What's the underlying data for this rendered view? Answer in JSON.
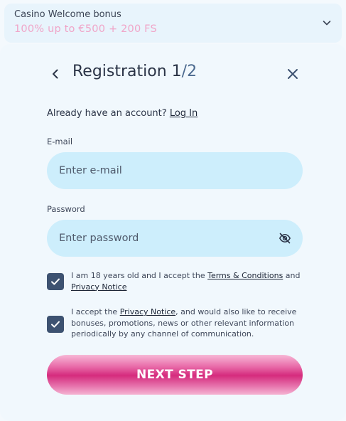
{
  "bonus": {
    "title": "Casino Welcome bonus",
    "offer": "100% up to €500 + 200 FS",
    "icon": "chevron-down-icon"
  },
  "header": {
    "title_main": "Registration 1",
    "title_sep": "/",
    "title_total": "2",
    "back_icon": "chevron-left-icon",
    "close_icon": "close-icon"
  },
  "account": {
    "prompt": "Already have an account?",
    "login_label": "Log In"
  },
  "form": {
    "email_label": "E-mail",
    "email_placeholder": "Enter e-mail",
    "email_value": "",
    "password_label": "Password",
    "password_placeholder": "Enter password",
    "password_value": "",
    "password_icon": "eye-off-icon"
  },
  "consents": [
    {
      "checked": true,
      "pre": "I am 18 years old and I accept the ",
      "link1": "Terms & Conditions",
      "mid": " and ",
      "link2": "Privacy Notice"
    },
    {
      "checked": true,
      "pre": "I accept the ",
      "link1": "Privacy Notice",
      "post": ", and would also like to receive bonuses, promotions, news or other relevant information periodically by any channel of communication."
    }
  ],
  "next_button_label": "NEXT STEP",
  "colors": {
    "accent": "#d52b7d",
    "input_bg": "#cdeefc",
    "checkbox": "#3d5271",
    "offer_text": "#f0a5c8"
  }
}
